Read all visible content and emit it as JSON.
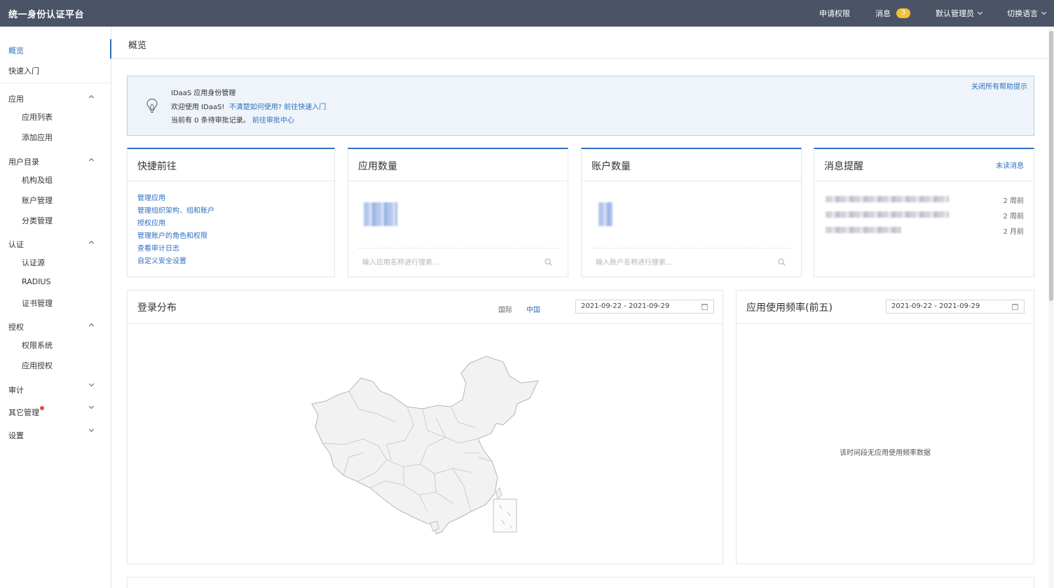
{
  "topbar": {
    "brand": "统一身份认证平台",
    "apply_permission": "申请权限",
    "messages": "消息",
    "message_count": "3",
    "admin": "默认管理员",
    "language": "切换语言"
  },
  "sidebar": {
    "overview": "概览",
    "quick_start": "快速入门",
    "apps": "应用",
    "app_list": "应用列表",
    "add_app": "添加应用",
    "user_dir": "用户目录",
    "org_group": "机构及组",
    "account_mgmt": "账户管理",
    "category_mgmt": "分类管理",
    "auth": "认证",
    "auth_source": "认证源",
    "radius": "RADIUS",
    "cert_mgmt": "证书管理",
    "authorize": "授权",
    "perm_system": "权限系统",
    "app_auth": "应用授权",
    "audit": "审计",
    "other_mgmt": "其它管理",
    "settings": "设置"
  },
  "page": {
    "title": "概览"
  },
  "help": {
    "title": "IDaaS 应用身份管理",
    "welcome": "欢迎使用 IDaaS!",
    "welcome_link": "不清楚如何使用? 前往快速入门",
    "pending": "当前有 0 条待审批记录。",
    "pending_link": "前往审批中心",
    "close_all": "关闭所有帮助提示"
  },
  "quick": {
    "title": "快捷前往",
    "links": [
      "管理应用",
      "管理组织架构、组和账户",
      "授权应用",
      "管理账户的角色和权限",
      "查看审计日志",
      "自定义安全设置"
    ]
  },
  "apps_count": {
    "title": "应用数量",
    "search_placeholder": "输入应用名称进行搜索..."
  },
  "accounts_count": {
    "title": "账户数量",
    "search_placeholder": "输入账户名称进行搜索..."
  },
  "notices": {
    "title": "消息提醒",
    "unread": "未读消息",
    "items": [
      {
        "time": "2 周前"
      },
      {
        "time": "2 周前"
      },
      {
        "time": "2 月前"
      }
    ]
  },
  "login_dist": {
    "title": "登录分布",
    "tab_intl": "国际",
    "tab_china": "中国",
    "date_range": "2021-09-22 - 2021-09-29"
  },
  "app_freq": {
    "title": "应用使用频率(前五)",
    "date_range": "2021-09-22 - 2021-09-29",
    "empty": "该时间段无应用使用频率数据"
  },
  "colors": {
    "accent": "#2f6fbf",
    "topbar": "#4a5466",
    "badge": "#f5c233",
    "dot": "#e84c3d"
  }
}
